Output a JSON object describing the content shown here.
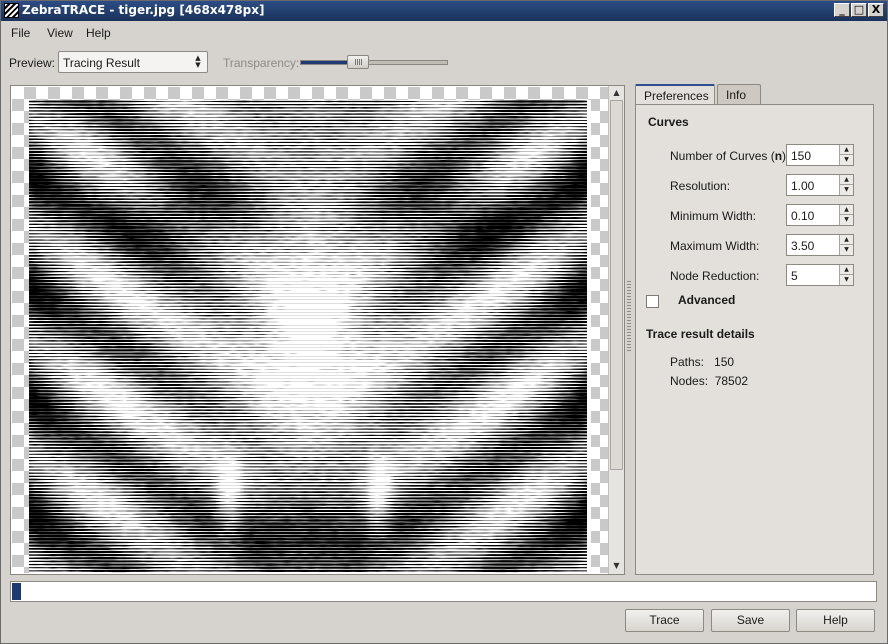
{
  "window": {
    "title": "ZebraTRACE - tiger.jpg [468x478px]",
    "min": "_",
    "max": "□",
    "close": "X"
  },
  "menu": {
    "items": [
      "File",
      "View",
      "Help"
    ]
  },
  "toolbar": {
    "preview_label": "Preview:",
    "preview_value": "Tracing Result",
    "transparency_label": "Transparency:",
    "transparency_level": 0.37
  },
  "tabs": {
    "preferences": "Preferences",
    "info": "Info",
    "active": "Preferences"
  },
  "curves": {
    "title": "Curves",
    "fields": [
      {
        "label_pre": "Number of Curves (",
        "label_bold": "n",
        "label_post": "):",
        "value": "150"
      },
      {
        "label": "Resolution:",
        "value": "1.00"
      },
      {
        "label": "Minimum Width:",
        "value": "0.10"
      },
      {
        "label": "Maximum Width:",
        "value": "3.50"
      },
      {
        "label": "Node Reduction:",
        "value": "5"
      }
    ],
    "advanced_label": "Advanced",
    "advanced_checked": false
  },
  "trace_details": {
    "title": "Trace result details",
    "paths_label": "Paths:",
    "paths_value": "150",
    "nodes_label": "Nodes:",
    "nodes_value": "78502"
  },
  "progress": {
    "value": 0.01,
    "color": "#1f3a73"
  },
  "buttons": {
    "trace": "Trace",
    "save": "Save",
    "help": "Help"
  },
  "colors": {
    "titlebar": "#23406f",
    "accent": "#2d4f90",
    "image_ink": "#000000"
  }
}
